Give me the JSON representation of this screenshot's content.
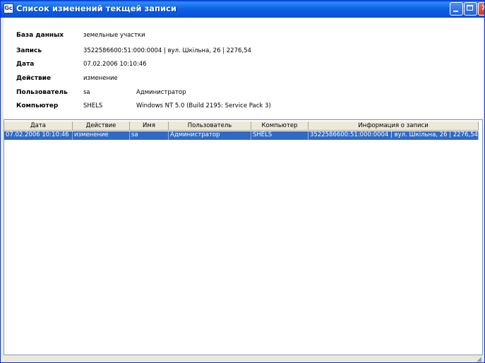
{
  "window": {
    "title": "Список изменений текщей записи",
    "icon_name": "app-icon",
    "buttons": [
      "minimize-icon",
      "maximize-icon",
      "close-icon"
    ]
  },
  "info": {
    "database_label": "База данных",
    "database_value": "земельные участки",
    "record_label": "Запись",
    "record_value": "3522586600:51:000:0004 | вул. Шкільна, 26 | 2276,54",
    "date_label": "Дата",
    "date_value": "07.02.2006 10:10:46",
    "action_label": "Действие",
    "action_value": "изменение",
    "user_label": "Пользователь",
    "user_login": "sa",
    "user_name": "Администратор",
    "computer_label": "Компьютер",
    "computer_name": "SHELS",
    "computer_os": "Windows NT 5.0 (Build 2195: Service Pack 3)"
  },
  "table": {
    "columns": [
      "Дата",
      "Действие",
      "Имя",
      "Пользователь",
      "Компьютер",
      "Информация о записи"
    ],
    "rows": [
      [
        "07.02.2006 10:10:46",
        "изменение",
        "sa",
        "Администратор",
        "SHELS",
        "3522586600:51:000:0004 | вул. Шкільна, 26 | 2276,54"
      ]
    ]
  },
  "colors": {
    "selection": "#316ac5",
    "titlebar": "#0754dd"
  }
}
